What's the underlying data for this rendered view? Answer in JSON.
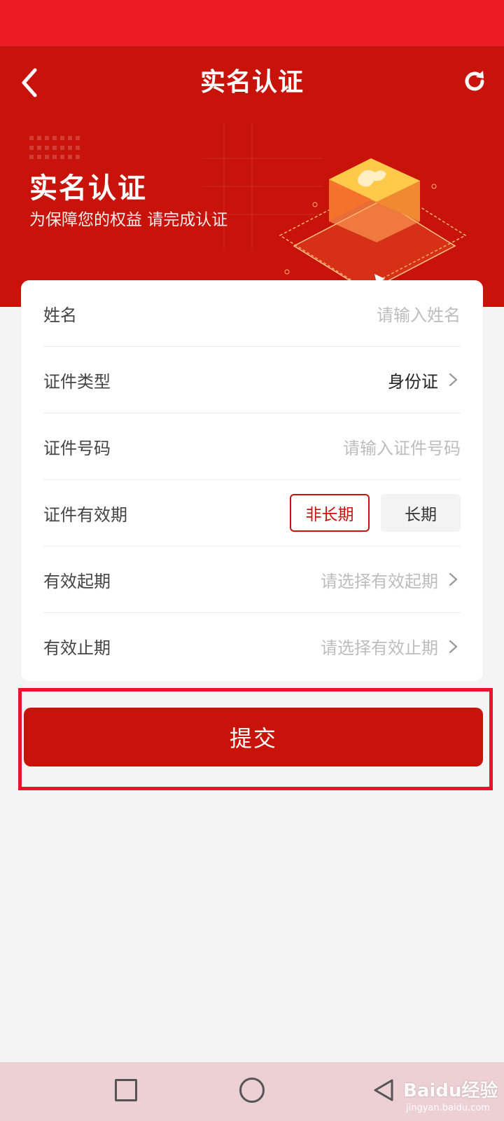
{
  "nav": {
    "title": "实名认证"
  },
  "hero": {
    "title": "实名认证",
    "subtitle": "为保障您的权益 请完成认证"
  },
  "form": {
    "name": {
      "label": "姓名",
      "placeholder": "请输入姓名"
    },
    "id_type": {
      "label": "证件类型",
      "value": "身份证"
    },
    "id_number": {
      "label": "证件号码",
      "placeholder": "请输入证件号码"
    },
    "validity": {
      "label": "证件有效期",
      "options": [
        "非长期",
        "长期"
      ],
      "selected": "非长期"
    },
    "start_date": {
      "label": "有效起期",
      "placeholder": "请选择有效起期"
    },
    "end_date": {
      "label": "有效止期",
      "placeholder": "请选择有效止期"
    }
  },
  "submit": {
    "label": "提交"
  },
  "watermark": {
    "brand": "Baidu经验",
    "url": "jingyan.baidu.com"
  },
  "colors": {
    "primary": "#c8130b",
    "status_bar": "#ec1c24",
    "highlight": "#e8142a"
  },
  "icons": [
    "back-arrow-icon",
    "refresh-icon",
    "chevron-right-icon",
    "recent-apps-icon",
    "home-icon",
    "back-icon"
  ]
}
